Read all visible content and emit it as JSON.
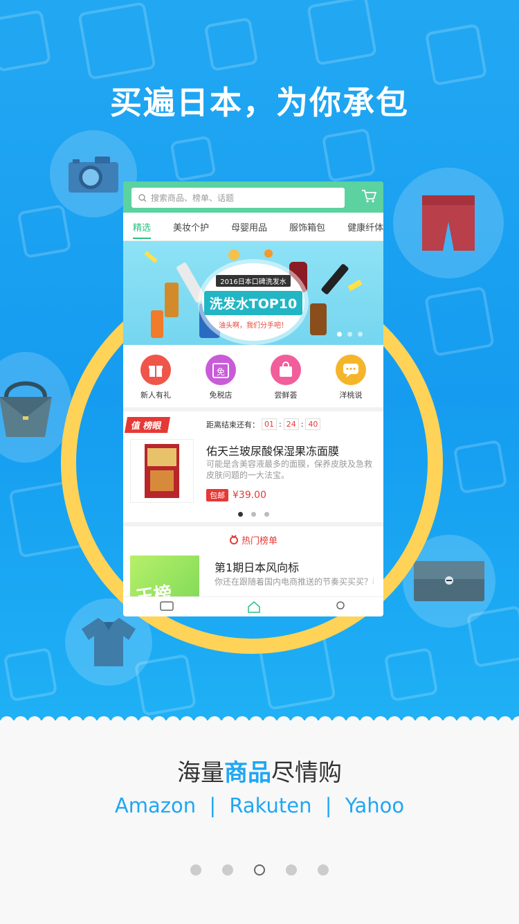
{
  "hero": {
    "title": "买遍日本，为你承包"
  },
  "app": {
    "search_placeholder": "搜索商品、榜单、话题",
    "tabs": [
      {
        "label": "精选",
        "active": true
      },
      {
        "label": "美妆个护"
      },
      {
        "label": "母婴用品"
      },
      {
        "label": "服饰箱包"
      },
      {
        "label": "健康纤体"
      }
    ],
    "banner": {
      "line1": "2016日本口碑洗发水",
      "line2": "洗发水TOP10",
      "line3": "油头啊，我们分手吧！"
    },
    "quick_links": [
      {
        "label": "新人有礼",
        "color": "#f0554a",
        "icon": "gift-icon"
      },
      {
        "label": "免税店",
        "color": "#c95bd8",
        "icon": "calendar-icon",
        "glyph": "免"
      },
      {
        "label": "尝鲜荟",
        "color": "#f25e9a",
        "icon": "bag-icon"
      },
      {
        "label": "洋桃说",
        "color": "#f5b52a",
        "icon": "chat-icon"
      }
    ],
    "deal": {
      "tag": "值 榜眼",
      "countdown_label": "距离结束还有：",
      "hours": "01",
      "minutes": "24",
      "seconds": "40",
      "title": "佑天兰玻尿酸保湿果冻面膜",
      "desc": "可能是含美容液最多的面膜，保养皮肤及急救皮肤问题的一大法宝。",
      "shipping_tag": "包邮",
      "price": "¥39.00"
    },
    "hot": {
      "header": "热门榜单",
      "image_text": "王榜",
      "title": "第1期日本风向标",
      "desc": "你还在跟随着国内电商推送的节奏买买买？看看真实的日本热销榜，你会"
    }
  },
  "bottom": {
    "slogan_pre": "海量",
    "slogan_hl": "商品",
    "slogan_post": "尽情购",
    "brand1": "Amazon",
    "brand2": "Rakuten",
    "brand3": "Yahoo",
    "separator": "|"
  },
  "pager": {
    "total": 5,
    "current": 3
  },
  "colors": {
    "sky": "#1ea7f4",
    "ring": "#ffd357",
    "accent_green": "#5bd2a0",
    "price_red": "#e53935"
  }
}
